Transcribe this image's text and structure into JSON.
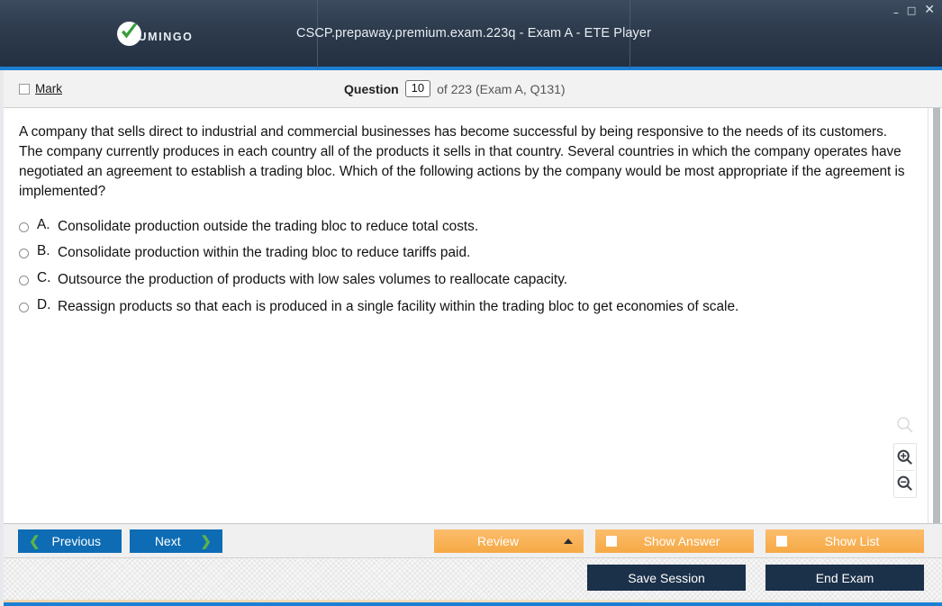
{
  "window": {
    "title": "CSCP.prepaway.premium.exam.223q - Exam A - ETE Player",
    "logo_text": "UMINGO",
    "minimize": "–",
    "maximize": "□",
    "close": "✕"
  },
  "question_header": {
    "mark_label": "Mark",
    "question_label": "Question",
    "question_number": "10",
    "of_text": "of 223 (Exam A, Q131)"
  },
  "question": {
    "text": "A company that sells direct to industrial and commercial businesses has become successful by being responsive to the needs of its customers. The company currently produces in each country all of the products it sells in that country. Several countries in which the company operates have negotiated an agreement to establish a trading bloc. Which of the following actions by the company would be most appropriate if the agreement is implemented?",
    "options": [
      {
        "letter": "A.",
        "text": "Consolidate production outside the trading bloc to reduce total costs."
      },
      {
        "letter": "B.",
        "text": "Consolidate production within the trading bloc to reduce tariffs paid."
      },
      {
        "letter": "C.",
        "text": "Outsource the production of products with low sales volumes to reallocate capacity."
      },
      {
        "letter": "D.",
        "text": "Reassign products so that each is produced in a single facility within the trading bloc to get economies of scale."
      }
    ]
  },
  "toolbar": {
    "previous": "Previous",
    "next": "Next",
    "review": "Review",
    "show_answer": "Show Answer",
    "show_list": "Show List",
    "prev_chevron": "❮",
    "next_chevron": "❯"
  },
  "footer": {
    "save_session": "Save Session",
    "end_exam": "End Exam"
  },
  "colors": {
    "titlebar_dark": "#2d3b4d",
    "accent_blue": "#1c7fd4",
    "nav_button_blue": "#0d6cb4",
    "orange_button": "#f9b35a",
    "dark_button": "#1b3049",
    "chevron_green": "#5bb24a"
  }
}
